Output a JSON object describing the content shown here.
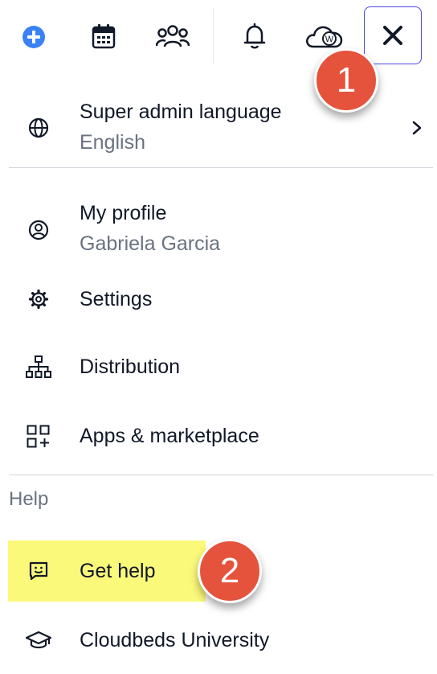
{
  "topbar": {
    "icons": [
      "add-icon",
      "calendar-icon",
      "users-icon",
      "bell-icon",
      "cloud-w-icon",
      "close-icon"
    ],
    "accent_color": "#3b82f6",
    "close_border_color": "#4f46e5"
  },
  "annotations": {
    "badge1": "1",
    "badge2": "2",
    "badge_color": "#e5533d",
    "highlight_color": "#fbf97a"
  },
  "menu": {
    "language": {
      "label": "Super admin language",
      "value": "English"
    },
    "profile": {
      "label": "My profile",
      "value": "Gabriela Garcia"
    },
    "settings": {
      "label": "Settings"
    },
    "distribution": {
      "label": "Distribution"
    },
    "apps": {
      "label": "Apps & marketplace"
    },
    "help_section": "Help",
    "get_help": {
      "label": "Get help"
    },
    "university": {
      "label": "Cloudbeds University"
    }
  }
}
